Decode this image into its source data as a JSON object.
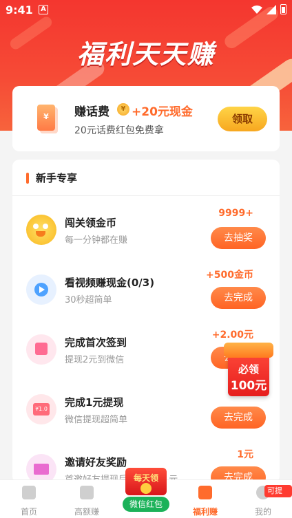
{
  "status_bar": {
    "time": "9:41",
    "app_indicator": "A"
  },
  "hero": {
    "title": "福利天天赚"
  },
  "top_card": {
    "icon": "¥",
    "title": "赚话费",
    "coin_icon": "¥",
    "bonus": "+20元现金",
    "subtitle": "20元话费红包免费拿",
    "button": "领取"
  },
  "section": {
    "title": "新手专享"
  },
  "tasks": [
    {
      "title": "闯关领金币",
      "desc": "每一分钟都在赚",
      "reward": "9999+",
      "button": "去抽奖"
    },
    {
      "title": "看视频赚现金(0/3)",
      "desc": "30秒超简单",
      "reward": "+500金币",
      "button": "去完成"
    },
    {
      "title": "完成首次签到",
      "desc": "提现2元到微信",
      "reward": "+2.00元",
      "button": "去完成"
    },
    {
      "title": "完成1元提现",
      "desc": "微信提现超简单",
      "icon_text": "¥1.0",
      "reward": "",
      "button": "去完成"
    },
    {
      "title": "邀请好友奖励",
      "desc": "首邀好友提现后额外奖励1元",
      "reward": "1元",
      "button": "去完成"
    }
  ],
  "floating_redpack": {
    "line1": "必领",
    "line2": "100元"
  },
  "tabbar": {
    "items": [
      {
        "label": "首页",
        "icon": "home-icon"
      },
      {
        "label": "高额赚",
        "icon": "money-bag-icon"
      },
      {
        "label": "福利赚",
        "icon": "gift-icon",
        "active": true
      },
      {
        "label": "我的",
        "icon": "user-icon"
      }
    ],
    "center": {
      "envelope_label": "每天领",
      "pill_label": "微信红包"
    },
    "withdraw_badge": "可提现"
  },
  "colors": {
    "accent": "#ff6b2c",
    "hero_red": "#f4362f",
    "wechat_green": "#1bb259"
  }
}
